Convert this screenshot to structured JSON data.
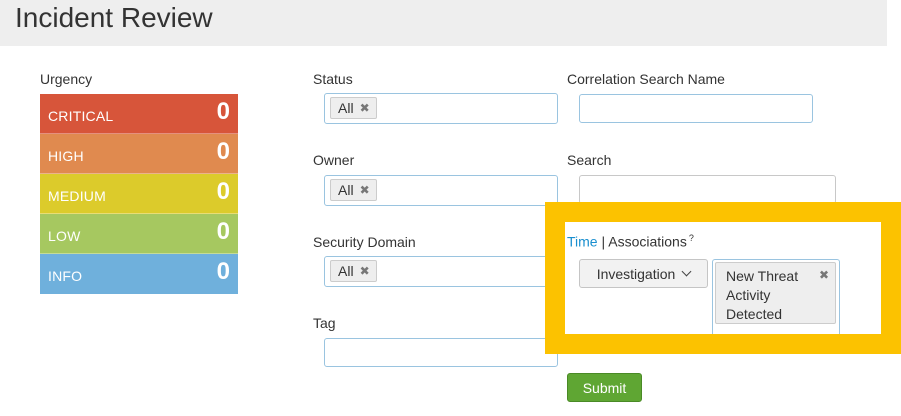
{
  "page": {
    "title": "Incident Review"
  },
  "urgency": {
    "label": "Urgency",
    "items": [
      {
        "name": "CRITICAL",
        "count": "0",
        "color": "#d7553a"
      },
      {
        "name": "HIGH",
        "count": "0",
        "color": "#e08a4f"
      },
      {
        "name": "MEDIUM",
        "count": "0",
        "color": "#dccb2b"
      },
      {
        "name": "LOW",
        "count": "0",
        "color": "#a6c860"
      },
      {
        "name": "INFO",
        "count": "0",
        "color": "#6fb0dc"
      }
    ]
  },
  "filters": {
    "status": {
      "label": "Status",
      "token": "All"
    },
    "owner": {
      "label": "Owner",
      "token": "All"
    },
    "security_domain": {
      "label": "Security Domain",
      "token": "All"
    },
    "tag": {
      "label": "Tag",
      "value": ""
    },
    "correlation_search_name": {
      "label": "Correlation Search Name",
      "value": ""
    },
    "search": {
      "label": "Search",
      "value": ""
    }
  },
  "associations": {
    "tab_time": "Time",
    "separator": "|",
    "tab_associations": "Associations",
    "help": "?",
    "dropdown_label": "Investigation",
    "selected": "New Threat Activity Detected",
    "remove": "✖"
  },
  "actions": {
    "submit_label": "Submit"
  },
  "colors": {
    "highlight": "#fcc200",
    "accent": "#1a8fcf",
    "submit": "#5fa633"
  }
}
